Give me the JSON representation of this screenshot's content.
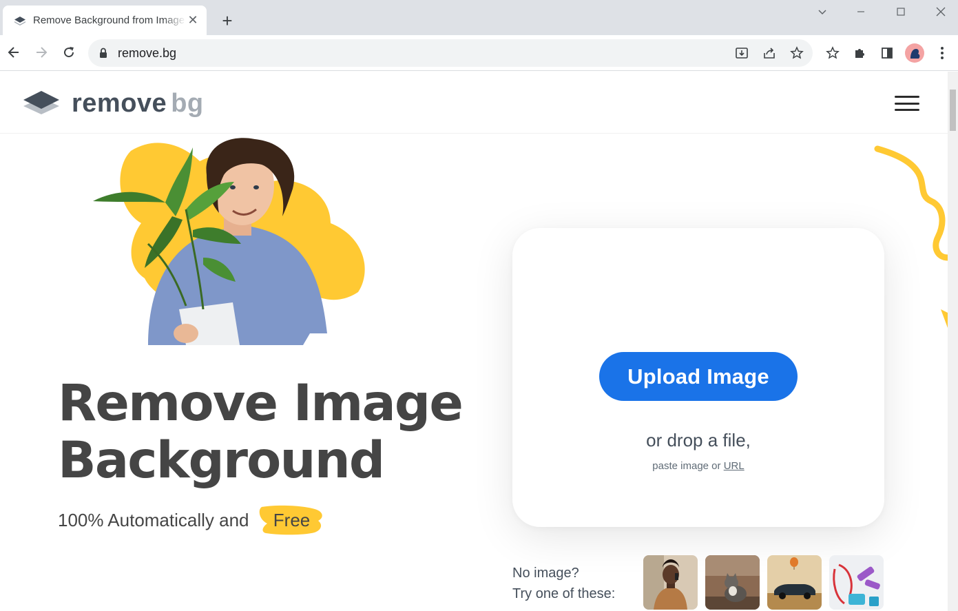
{
  "browser": {
    "tab_title": "Remove Background from Image",
    "url": "remove.bg"
  },
  "header": {
    "logo_primary": "remove",
    "logo_secondary": "bg"
  },
  "hero": {
    "headline_line1": "Remove Image",
    "headline_line2": "Background",
    "subline": "100% Automatically and",
    "free_badge": "Free"
  },
  "upload": {
    "button_label": "Upload Image",
    "drop_text": "or drop a file,",
    "paste_text": "paste image or",
    "url_link": "URL"
  },
  "samples": {
    "line1": "No image?",
    "line2": "Try one of these:",
    "thumbnails": [
      "person-on-phone",
      "cat",
      "vintage-car",
      "fitness-gear"
    ]
  },
  "colors": {
    "accent": "#1a73e8",
    "yellow": "#ffc933",
    "heading": "#454545"
  }
}
